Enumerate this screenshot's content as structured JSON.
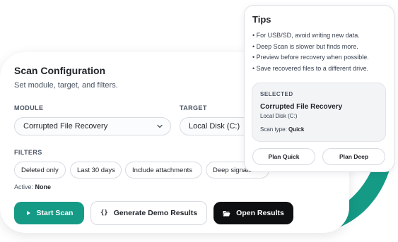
{
  "scan": {
    "title": "Scan Configuration",
    "subtitle": "Set module, target, and filters.",
    "module_label": "MODULE",
    "module_value": "Corrupted File Recovery",
    "target_label": "TARGET",
    "target_value": "Local Disk (C:)",
    "filters_label": "FILTERS",
    "filters": [
      "Deleted only",
      "Last 30 days",
      "Include attachments",
      "Deep signature"
    ],
    "active_prefix": "Active:",
    "active_value": "None",
    "start_label": "Start Scan",
    "demo_label": "Generate Demo Results",
    "open_label": "Open Results"
  },
  "tips": {
    "title": "Tips",
    "items": [
      "• For USB/SD, avoid writing new data.",
      "• Deep Scan is slower but finds more.",
      "• Preview before recovery when possible.",
      "• Save recovered files to a different drive."
    ],
    "selected_label": "SELECTED",
    "selected_title": "Corrupted File Recovery",
    "selected_sub": "Local Disk (C:)",
    "scan_type_prefix": "Scan type:",
    "scan_type_value": "Quick",
    "plan_quick": "Plan Quick",
    "plan_deep": "Plan Deep"
  },
  "colors": {
    "accent": "#159a86",
    "dark": "#0d0f11"
  }
}
